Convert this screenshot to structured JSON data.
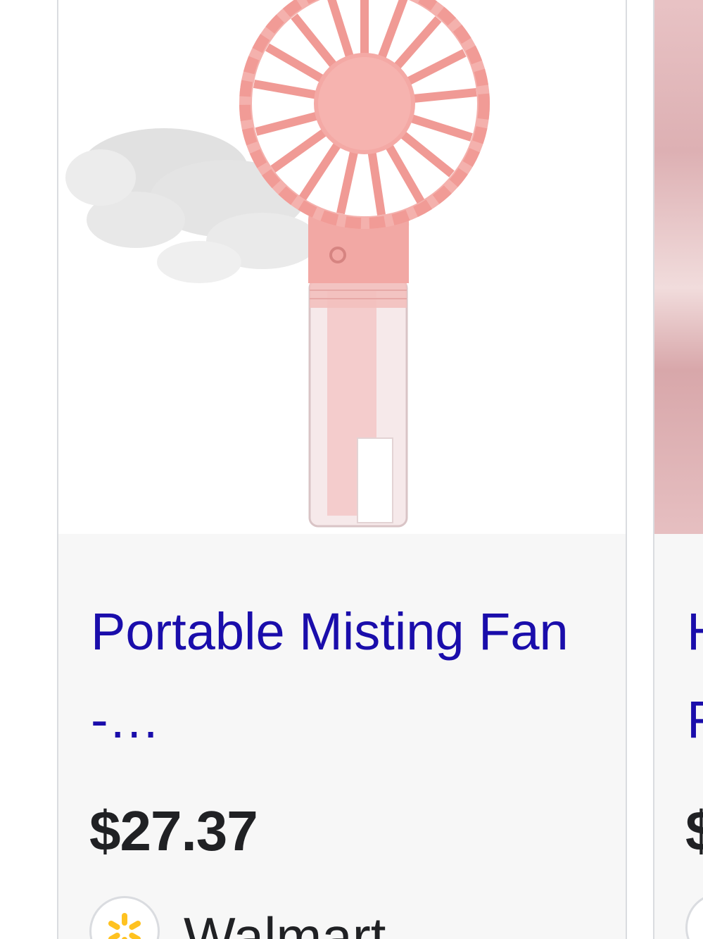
{
  "product_card": {
    "title": "Portable Misting Fan -…",
    "price": "$27.37",
    "merchant": "Walmart",
    "merchant_logo_icon": "walmart-spark-icon",
    "image_icon": "pink-handheld-misting-fan-image"
  },
  "next_card": {
    "title_fragment": "H F",
    "price_fragment": "$"
  },
  "colors": {
    "title_link": "#1a0dab",
    "price_text": "#202124",
    "card_background": "#f7f7f7",
    "card_border": "#dadce0",
    "fan_pink": "#f2a3a0",
    "walmart_spark": "#ffc220"
  }
}
